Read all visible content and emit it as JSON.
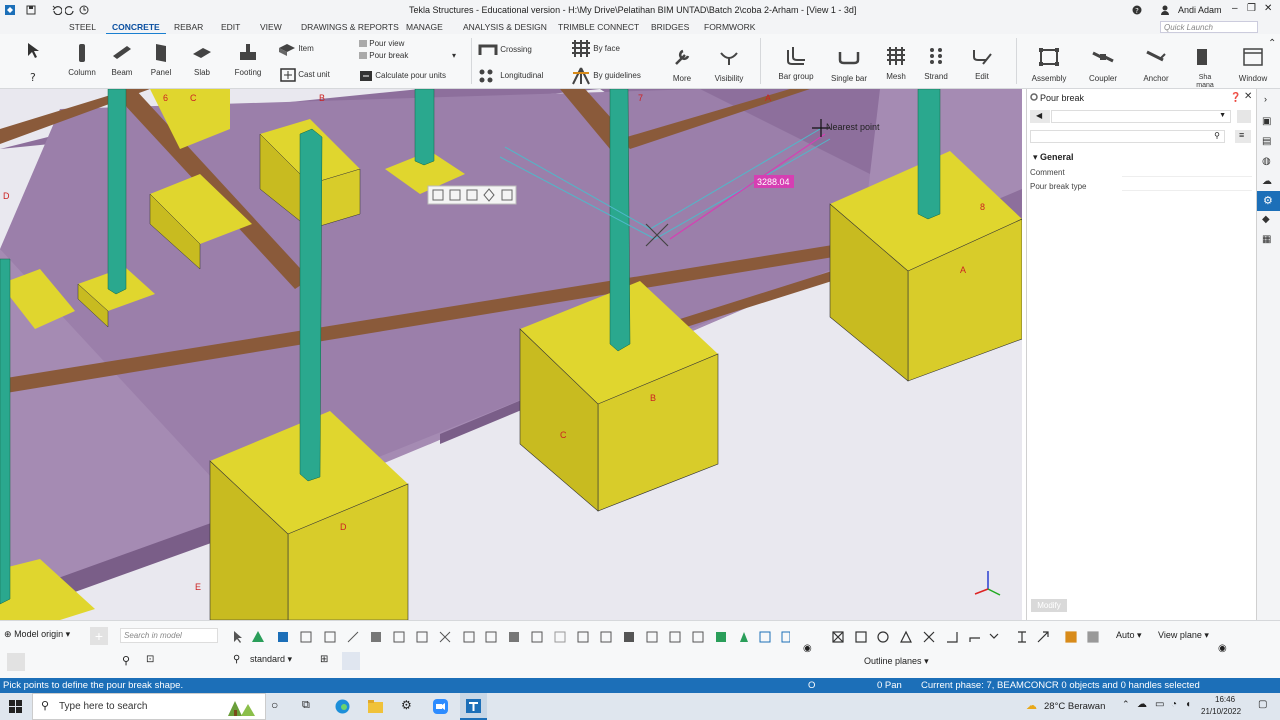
{
  "titlebar": {
    "title": "Tekla Structures - Educational version - H:\\My Drive\\Pelatihan BIM UNTAD\\Batch 2\\coba 2-Arham - [View 1 - 3d]",
    "user": "Andi Adam",
    "quick_launch_placeholder": "Quick Launch"
  },
  "tabs": [
    {
      "label": "STEEL"
    },
    {
      "label": "CONCRETE"
    },
    {
      "label": "REBAR"
    },
    {
      "label": "EDIT"
    },
    {
      "label": "VIEW"
    },
    {
      "label": "DRAWINGS & REPORTS"
    },
    {
      "label": "MANAGE"
    },
    {
      "label": "ANALYSIS & DESIGN"
    },
    {
      "label": "TRIMBLE CONNECT"
    },
    {
      "label": "BRIDGES"
    },
    {
      "label": "FORMWORK"
    }
  ],
  "ribbon": {
    "column": "Column",
    "beam": "Beam",
    "panel": "Panel",
    "slab": "Slab",
    "footing": "Footing",
    "item": "Item",
    "cast_unit": "Cast unit",
    "pour_view": "Pour view",
    "pour_break": "Pour break",
    "calc_pour_units": "Calculate pour units",
    "crossing": "Crossing",
    "longitudinal": "Longitudinal",
    "by_face": "By face",
    "by_guidelines": "By guidelines",
    "more": "More",
    "visibility": "Visibility",
    "bar_group": "Bar group",
    "single_bar": "Single bar",
    "mesh": "Mesh",
    "strand": "Strand",
    "edit": "Edit",
    "assembly": "Assembly",
    "coupler": "Coupler",
    "anchor": "Anchor",
    "shape_manager": "Sha mana",
    "window": "Window"
  },
  "viewport": {
    "snap_tooltip": "Nearest point",
    "dimension": "3288.04",
    "grid_labels": [
      "6",
      "C",
      "B",
      "7",
      "A",
      "8",
      "A",
      "B",
      "C",
      "D",
      "E",
      "D"
    ]
  },
  "props": {
    "title": "Pour break",
    "section_general": "General",
    "comment_label": "Comment",
    "pour_break_type_label": "Pour break type",
    "modify_button": "Modify"
  },
  "bottombar": {
    "model_origin": "Model origin",
    "search_placeholder": "Search in model",
    "standard": "standard",
    "auto": "Auto",
    "view_plane": "View plane",
    "outline_planes": "Outline planes"
  },
  "status": {
    "prompt": "Pick points to define the pour break shape.",
    "o": "O",
    "pan": "0 Pan",
    "phase": "Current phase: 7, BEAMCONCR 0 objects and 0 handles selected"
  },
  "taskbar": {
    "search_placeholder": "Type here to search",
    "weather": "28°C Berawan",
    "time": "16:46",
    "date": "21/10/2022"
  },
  "colors": {
    "slab": "#9b7faa",
    "footing": "#d8cc2a",
    "column": "#2aa88e",
    "beam": "#8a5a3a",
    "accent": "#1c6fb8",
    "dimension": "#d63fb3"
  }
}
